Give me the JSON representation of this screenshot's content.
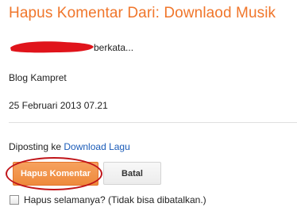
{
  "page": {
    "title": "Hapus Komentar Dari: Downlaod Musik"
  },
  "comment": {
    "author_suffix": "berkata...",
    "blog_name": "Blog Kampret",
    "date": "25 Februari 2013 07.21"
  },
  "post": {
    "prefix": "Diposting ke ",
    "link_label": "Download Lagu"
  },
  "actions": {
    "delete_label": "Hapus Komentar",
    "cancel_label": "Batal"
  },
  "options": {
    "permanent_label": "Hapus selamanya? (Tidak bisa dibatalkan.)"
  },
  "colors": {
    "accent": "#f0762b",
    "link": "#1a5bb8",
    "highlight": "#c0151a",
    "redaction": "#e0141b"
  }
}
